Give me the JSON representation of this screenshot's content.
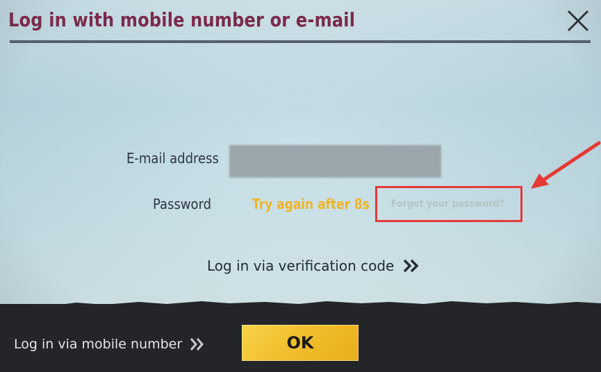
{
  "dialog": {
    "title": "Log in with mobile number or e-mail",
    "close_icon": "close-icon"
  },
  "form": {
    "email_label": "E-mail address",
    "email_value": "",
    "password_label": "Password",
    "retry_message": "Try again after 8s",
    "forgot_password": "Forgot your password?"
  },
  "links": {
    "verification_code": "Log in via verification code",
    "mobile_number": "Log in via mobile number",
    "chevron_icon": "double-chevron-right-icon"
  },
  "footer": {
    "ok_label": "OK"
  },
  "colors": {
    "title": "#7a2a4c",
    "retry_message": "#f0b428",
    "annotation": "#e53935",
    "ok_button": "#f2bf2e",
    "bottom_bar": "#232529"
  }
}
